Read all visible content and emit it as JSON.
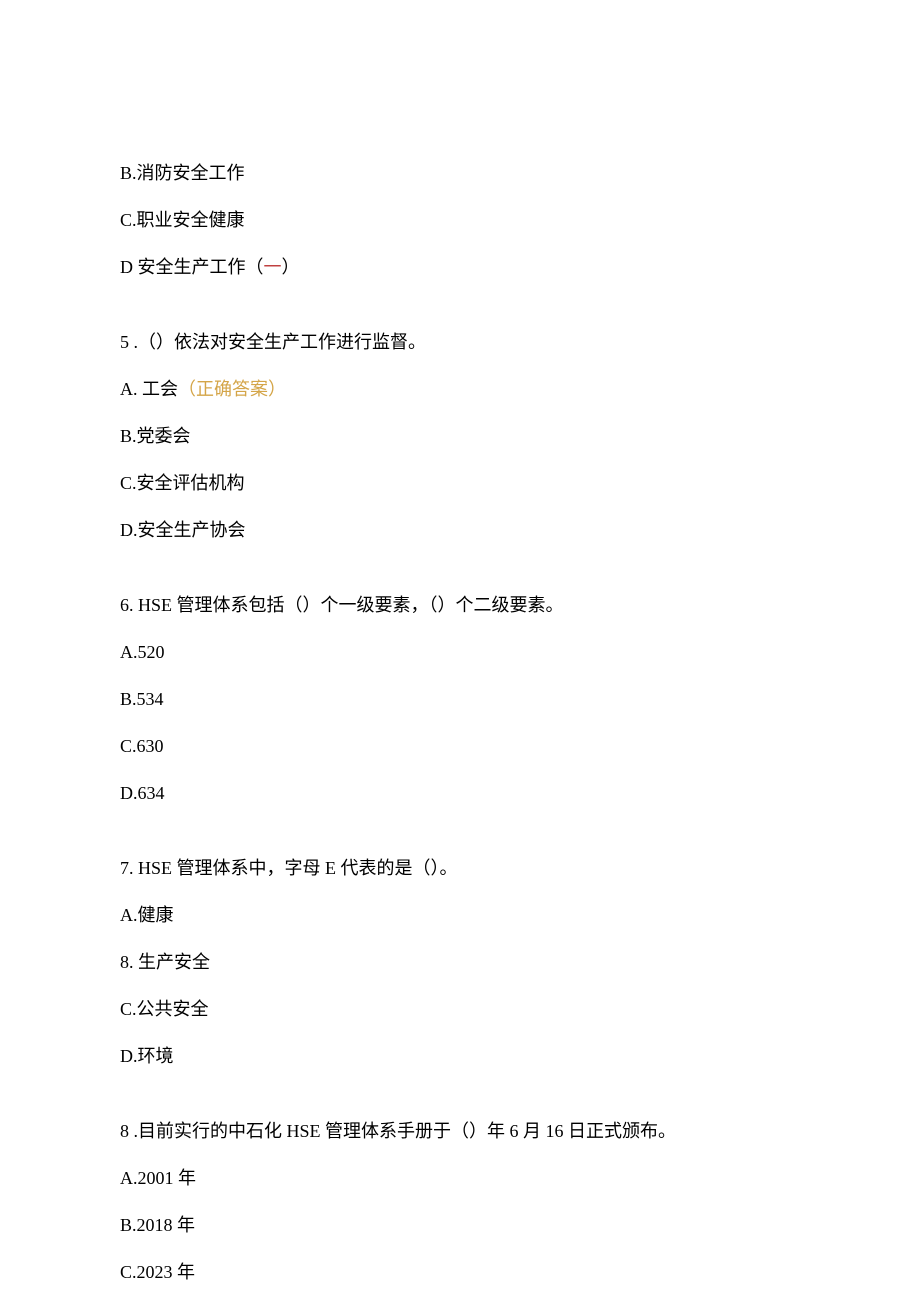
{
  "lines": {
    "q4_optB": "B.消防安全工作",
    "q4_optC": "C.职业安全健康",
    "q4_optD_prefix": "D 安全生产工作（",
    "q4_optD_mark": "一",
    "q4_optD_suffix": "）",
    "q5_stem": "5  .（）依法对安全生产工作进行监督。",
    "q5_optA_prefix": "A. 工会",
    "q5_optA_correct": "（正确答案）",
    "q5_optB": "B.党委会",
    "q5_optC": "C.安全评估机构",
    "q5_optD": "D.安全生产协会",
    "q6_stem": "6.   HSE 管理体系包括（）个一级要素，（）个二级要素。",
    "q6_optA": "A.520",
    "q6_optB": "B.534",
    "q6_optC": "C.630",
    "q6_optD": "D.634",
    "q7_stem": "7.   HSE 管理体系中，字母 E 代表的是（）。",
    "q7_optA": "A.健康",
    "q7_line8": "8.   生产安全",
    "q7_optC": "C.公共安全",
    "q7_optD": "D.环境",
    "q8_stem": "8  .目前实行的中石化 HSE 管理体系手册于（）年 6 月 16 日正式颁布。",
    "q8_optA": "A.2001 年",
    "q8_optB": "B.2018 年",
    "q8_optC": "C.2023 年"
  }
}
